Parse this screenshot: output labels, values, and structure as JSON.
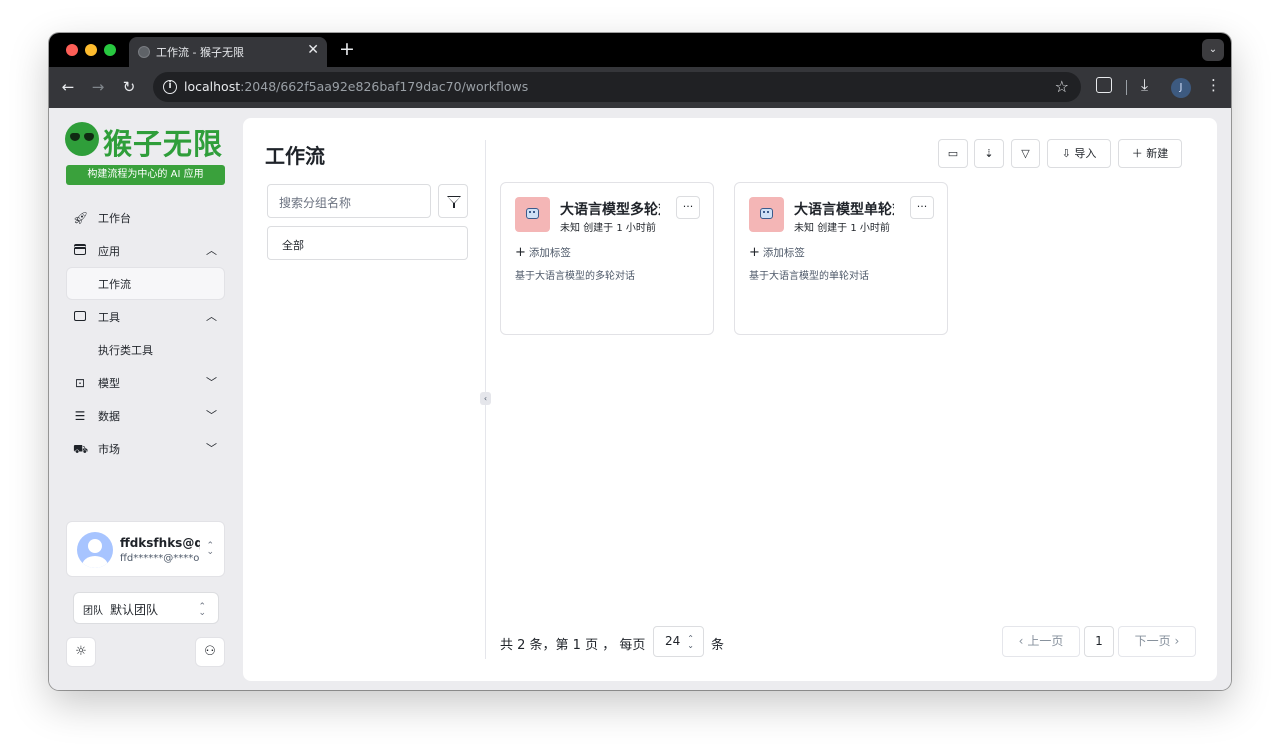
{
  "browser": {
    "tab_title": "工作流 - 猴子无限",
    "tab_close": "✕",
    "new_tab": "+",
    "url_host": "localhost",
    "url_rest": ":2048/662f5aa92e826baf179dac70/workflows",
    "profile_initial": "J",
    "icons": [
      "back-icon",
      "forward-icon",
      "reload-icon",
      "info-icon",
      "star-icon",
      "extensions-icon",
      "download-icon",
      "menu-icon"
    ]
  },
  "sidebar": {
    "logo_text": "猴子无限",
    "slogan": "构建流程为中心的 AI 应用",
    "menu": [
      {
        "label": "工作台",
        "icon": "rocket-icon"
      },
      {
        "label": "应用",
        "icon": "server-icon",
        "expanded": true
      },
      {
        "label": "工作流",
        "sub": true,
        "active": true
      },
      {
        "label": "工具",
        "icon": "calculator-icon",
        "expanded": true
      },
      {
        "label": "执行类工具",
        "sub": true
      },
      {
        "label": "模型",
        "icon": "model-icon",
        "expanded": false
      },
      {
        "label": "数据",
        "icon": "database-icon",
        "expanded": false
      },
      {
        "label": "市场",
        "icon": "cart-icon",
        "expanded": false
      }
    ],
    "user": {
      "name": "ffdksfhks@qq",
      "email": "ffd******@****o"
    },
    "team": {
      "badge": "团队",
      "name": "默认团队"
    }
  },
  "main": {
    "title": "工作流",
    "search_placeholder": "搜索分组名称",
    "group_all": "全部",
    "toolbar": {
      "import_label": "导入",
      "new_label": "新建"
    },
    "cards": [
      {
        "title": "大语言模型多轮对话",
        "author": "未知",
        "created": "创建于 1 小时前",
        "add_tag": "添加标签",
        "description": "基于大语言模型的多轮对话"
      },
      {
        "title": "大语言模型单轮对话",
        "author": "未知",
        "created": "创建于 1 小时前",
        "add_tag": "添加标签",
        "description": "基于大语言模型的单轮对话"
      }
    ],
    "pagination": {
      "summary": "共 2 条，第 1 页 ，",
      "per_page_label": "每页",
      "per_page_value": "24",
      "unit": "条",
      "prev_label": "上一页",
      "current_page": "1",
      "next_label": "下一页"
    }
  },
  "colors": {
    "brand_green": "#2f9e3a",
    "card_icon_bg": "#f4b6b6"
  }
}
